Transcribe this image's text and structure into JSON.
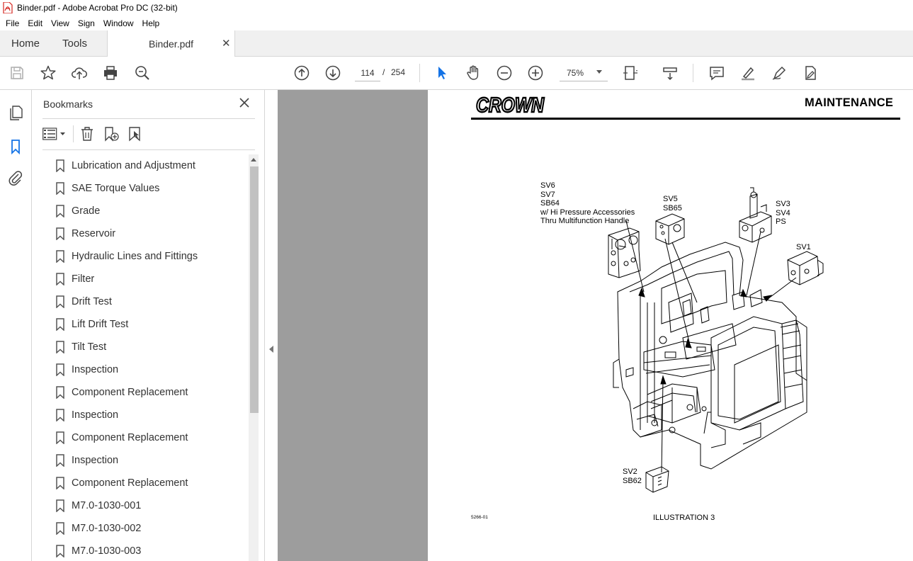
{
  "window": {
    "title": "Binder.pdf - Adobe Acrobat Pro DC (32-bit)"
  },
  "menu": [
    "File",
    "Edit",
    "View",
    "Sign",
    "Window",
    "Help"
  ],
  "tabs": {
    "home": "Home",
    "tools": "Tools",
    "document": "Binder.pdf"
  },
  "toolbar": {
    "current_page": "114",
    "page_separator": "/",
    "total_pages": "254",
    "zoom": "75%"
  },
  "bookmarks": {
    "title": "Bookmarks",
    "items": [
      "Lubrication and Adjustment",
      "SAE Torque Values",
      "Grade",
      "Reservoir",
      "Hydraulic Lines and Fittings",
      "Filter",
      "Drift Test",
      "Lift Drift Test",
      "Tilt Test",
      "Inspection",
      "Component Replacement",
      "Inspection",
      "Component Replacement",
      "Inspection",
      "Component Replacement",
      "M7.0-1030-001",
      "M7.0-1030-002",
      "M7.0-1030-003"
    ]
  },
  "page": {
    "brand": "CROWN",
    "header": "MAINTENANCE",
    "labels": {
      "group1": "SV6\nSV7\nSB64\nw/ Hi Pressure Accessories\nThru Multifunction Handle",
      "group2": "SV5\nSB65",
      "group3": "SV3\nSV4\nPS",
      "group4": "SV1",
      "group5": "SV2\nSB62"
    },
    "illustration_number": "5266-01",
    "illustration_caption": "ILLUSTRATION 3"
  },
  "colors": {
    "accent": "#1473e6",
    "doc_background": "#9d9d9d",
    "app_icon": "#d4251f"
  }
}
